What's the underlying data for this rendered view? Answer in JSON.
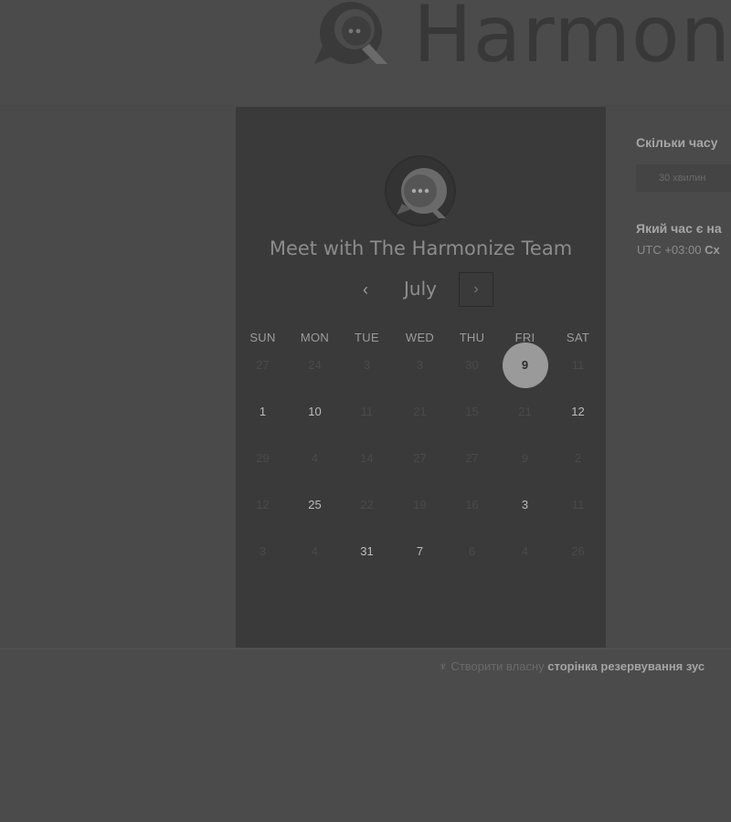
{
  "brand": {
    "name": "Harmon",
    "logo_icon": "chat-bubble-q-icon"
  },
  "card": {
    "logo_icon": "chat-bubble-logo-icon",
    "title": "Meet with The Harmonize Team"
  },
  "calendar": {
    "month": "July",
    "prev_icon": "chevron-left-icon",
    "next_icon": "chevron-right-icon",
    "prev_glyph": "‹",
    "next_glyph": "›",
    "weekdays": [
      "SUN",
      "MON",
      "TUE",
      "WED",
      "THU",
      "FRI",
      "SAT"
    ],
    "weeks": [
      [
        {
          "label": "27",
          "available": false
        },
        {
          "label": "24",
          "available": false
        },
        {
          "label": "3",
          "available": false
        },
        {
          "label": "3",
          "available": false
        },
        {
          "label": "30",
          "available": false
        },
        {
          "label": "9",
          "available": true,
          "selected": true
        },
        {
          "label": "11",
          "available": false
        }
      ],
      [
        {
          "label": "1",
          "available": true
        },
        {
          "label": "10",
          "available": true
        },
        {
          "label": "11",
          "available": false
        },
        {
          "label": "21",
          "available": false
        },
        {
          "label": "15",
          "available": false
        },
        {
          "label": "21",
          "available": false
        },
        {
          "label": "12",
          "available": true
        }
      ],
      [
        {
          "label": "29",
          "available": false
        },
        {
          "label": "4",
          "available": false
        },
        {
          "label": "14",
          "available": false
        },
        {
          "label": "27",
          "available": false
        },
        {
          "label": "27",
          "available": false
        },
        {
          "label": "9",
          "available": false
        },
        {
          "label": "2",
          "available": false
        }
      ],
      [
        {
          "label": "12",
          "available": false
        },
        {
          "label": "25",
          "available": true
        },
        {
          "label": "22",
          "available": false
        },
        {
          "label": "19",
          "available": false
        },
        {
          "label": "16",
          "available": false
        },
        {
          "label": "3",
          "available": true
        },
        {
          "label": "11",
          "available": false
        }
      ],
      [
        {
          "label": "3",
          "available": false
        },
        {
          "label": "4",
          "available": false
        },
        {
          "label": "31",
          "available": true
        },
        {
          "label": "7",
          "available": true
        },
        {
          "label": "6",
          "available": false
        },
        {
          "label": "4",
          "available": false
        },
        {
          "label": "26",
          "available": false
        }
      ]
    ]
  },
  "panel": {
    "duration_title": "Скільки часу",
    "duration_value": "30 хвилин",
    "timezone_title": "Який час є на",
    "timezone_prefix": "UTC +03:00",
    "timezone_name": "Сх"
  },
  "footer": {
    "sprout_icon": "sprout-icon",
    "text": "Створити власну",
    "link": "сторінка резервування зус"
  }
}
